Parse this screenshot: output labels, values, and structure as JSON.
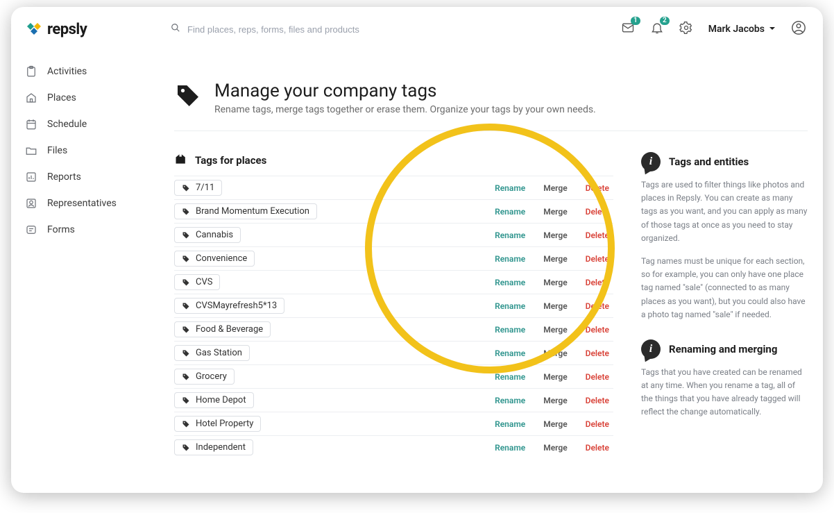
{
  "brand": {
    "name": "repsly"
  },
  "search": {
    "placeholder": "Find places, reps, forms, files and products"
  },
  "notifications": {
    "inbox_count": "1",
    "bell_count": "2"
  },
  "user": {
    "name": "Mark Jacobs"
  },
  "sidebar": {
    "items": [
      {
        "label": "Activities"
      },
      {
        "label": "Places"
      },
      {
        "label": "Schedule"
      },
      {
        "label": "Files"
      },
      {
        "label": "Reports"
      },
      {
        "label": "Representatives"
      },
      {
        "label": "Forms"
      }
    ]
  },
  "page": {
    "title": "Manage your company tags",
    "subtitle": "Rename tags, merge tags together or erase them. Organize your tags by your own needs."
  },
  "section": {
    "title": "Tags for places"
  },
  "actions": {
    "rename": "Rename",
    "merge": "Merge",
    "delete": "Delete"
  },
  "tags": [
    {
      "name": "7/11"
    },
    {
      "name": "Brand Momentum Execution"
    },
    {
      "name": "Cannabis"
    },
    {
      "name": "Convenience"
    },
    {
      "name": "CVS"
    },
    {
      "name": "CVSMayrefresh5*13"
    },
    {
      "name": "Food & Beverage"
    },
    {
      "name": "Gas Station"
    },
    {
      "name": "Grocery"
    },
    {
      "name": "Home Depot"
    },
    {
      "name": "Hotel Property"
    },
    {
      "name": "Independent"
    }
  ],
  "info": {
    "block1_title": "Tags and entities",
    "block1_p1": "Tags are used to filter things like photos and places in Repsly. You can create as many tags as you want, and you can apply as many of those tags at once as you need to stay organized.",
    "block1_p2": "Tag names must be unique for each section, so for example, you can only have one place tag named \"sale\" (connected to as many places as you want), but you could also have a photo tag named \"sale\" if needed.",
    "block2_title": "Renaming and merging",
    "block2_p1": "Tags that you have created can be renamed at any time. When you rename a tag, all of the things that you have already tagged will reflect the change automatically."
  }
}
